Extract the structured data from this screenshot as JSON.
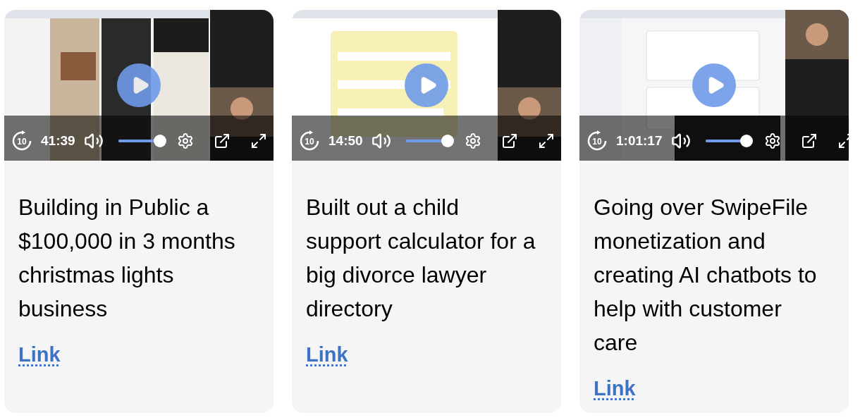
{
  "cards": [
    {
      "video": {
        "kind": "picture",
        "skip_label": "10",
        "time": "41:39",
        "volume": {
          "level": 0.95
        }
      },
      "title": "Building in Public a $100,000 in 3 months christmas lights business",
      "link": "Link"
    },
    {
      "video": {
        "kind": "picture",
        "skip_label": "10",
        "time": "14:50",
        "volume": {
          "level": 0.95
        }
      },
      "title": "Built out a child support calculator for a big divorce lawyer directory",
      "link": "Link"
    },
    {
      "video": {
        "kind": "picture",
        "skip_label": "10",
        "time": "1:01:17",
        "volume": {
          "level": 0.95
        }
      },
      "title": "Going over SwipeFile monetization and creating AI chatbots to help with customer care",
      "link": "Link"
    }
  ]
}
